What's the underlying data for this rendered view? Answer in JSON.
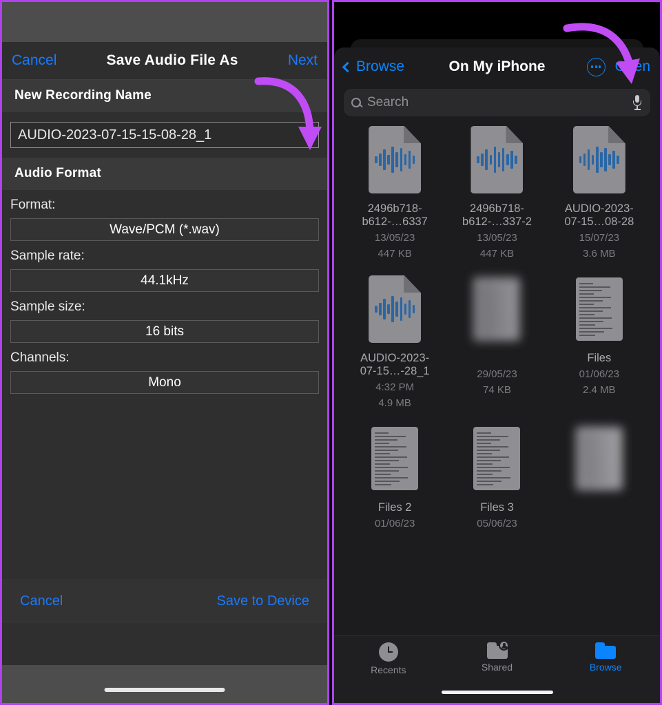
{
  "left_panel": {
    "navbar": {
      "cancel_label": "Cancel",
      "title": "Save Audio File As",
      "next_label": "Next"
    },
    "sections": {
      "name_header": "New Recording Name",
      "format_header": "Audio Format"
    },
    "filename_field": {
      "value": "AUDIO-2023-07-15-15-08-28_1"
    },
    "fields": [
      {
        "label": "Format:",
        "value": "Wave/PCM (*.wav)"
      },
      {
        "label": "Sample rate:",
        "value": "44.1kHz"
      },
      {
        "label": "Sample size:",
        "value": "16 bits"
      },
      {
        "label": "Channels:",
        "value": "Mono"
      }
    ],
    "footer": {
      "cancel_label": "Cancel",
      "save_label": "Save to Device"
    }
  },
  "right_panel": {
    "navbar": {
      "back_label": "Browse",
      "title": "On My iPhone",
      "more_label": "",
      "open_label": "Open"
    },
    "search": {
      "placeholder": "Search"
    },
    "files": [
      {
        "name": "2496b718-b612-…6337",
        "date": "13/05/23",
        "size": "447 KB",
        "icon": "audio-file-icon",
        "blurred": false
      },
      {
        "name": "2496b718-b612-…337-2",
        "date": "13/05/23",
        "size": "447 KB",
        "icon": "audio-file-icon",
        "blurred": false
      },
      {
        "name": "AUDIO-2023-07-15…08-28",
        "date": "15/07/23",
        "size": "3.6 MB",
        "icon": "audio-file-icon",
        "blurred": false
      },
      {
        "name": "AUDIO-2023-07-15…-28_1",
        "date": "4:32 PM",
        "size": "4.9 MB",
        "icon": "audio-file-icon",
        "blurred": false
      },
      {
        "name": "",
        "date": "29/05/23",
        "size": "74 KB",
        "icon": "document-file-icon",
        "blurred": true
      },
      {
        "name": "Files",
        "date": "01/06/23",
        "size": "2.4 MB",
        "icon": "document-file-icon",
        "blurred": false
      },
      {
        "name": "Files 2",
        "date": "01/06/23",
        "size": "",
        "icon": "document-file-icon",
        "blurred": false
      },
      {
        "name": "Files 3",
        "date": "05/06/23",
        "size": "",
        "icon": "document-file-icon",
        "blurred": false
      },
      {
        "name": "",
        "date": "",
        "size": "",
        "icon": "id-document-file-icon",
        "blurred": true
      }
    ],
    "tabs": [
      {
        "label": "Recents",
        "icon": "clock-icon",
        "active": false
      },
      {
        "label": "Shared",
        "icon": "shared-folder-icon",
        "active": false
      },
      {
        "label": "Browse",
        "icon": "folder-icon",
        "active": true
      }
    ]
  },
  "annotations": {
    "arrow_color": "#c04cf5",
    "border_color": "#b042f0",
    "accent_blue": "#0a84ff"
  }
}
